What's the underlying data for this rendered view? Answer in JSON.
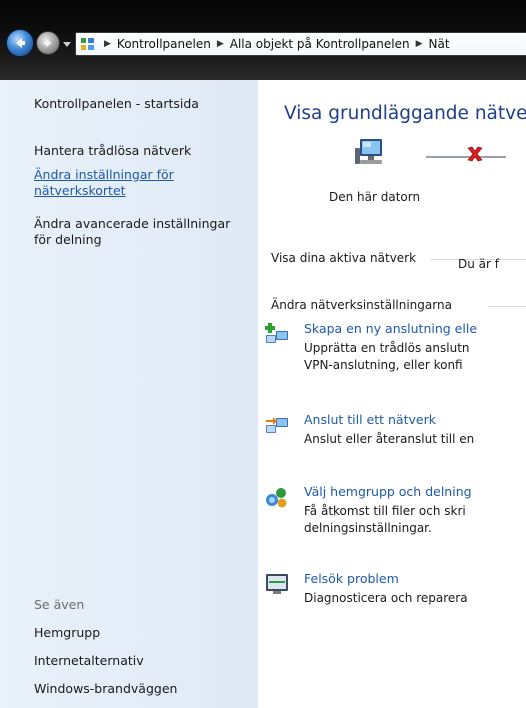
{
  "address": {
    "crumbs": [
      "Kontrollpanelen",
      "Alla objekt på Kontrollpanelen",
      "Nät"
    ]
  },
  "sidebar": {
    "home": "Kontrollpanelen - startsida",
    "items": [
      {
        "label": "Hantera trådlösa nätverk"
      },
      {
        "label_line1": "Ändra inställningar för",
        "label_line2": "nätverkskortet"
      },
      {
        "label_line1": "Ändra avancerade inställningar",
        "label_line2": "för delning"
      }
    ],
    "see_also_title": "Se även",
    "see_also": [
      "Hemgrupp",
      "Internetalternativ",
      "Windows-brandväggen"
    ]
  },
  "main": {
    "title": "Visa grundläggande nätverk",
    "computer_label": "Den här datorn",
    "active_networks_header": "Visa dina aktiva nätverk",
    "active_networks_text": "Du är f",
    "change_settings_header": "Ändra nätverksinställningarna",
    "tasks": [
      {
        "link": "Skapa en ny anslutning elle",
        "desc1": "Upprätta en trådlös anslutn",
        "desc2": "VPN-anslutning, eller konfi"
      },
      {
        "link": "Anslut till ett nätverk",
        "desc1": "Anslut eller återanslut till en"
      },
      {
        "link": "Välj hemgrupp och delning",
        "desc1": "Få åtkomst till filer och skri",
        "desc2": "delningsinställningar."
      },
      {
        "link": "Felsök problem",
        "desc1": "Diagnosticera och reparera"
      }
    ]
  },
  "colors": {
    "link": "#1e5aa8",
    "title": "#1e3f8a",
    "sidebar_bg": "#e4edf7",
    "error_red": "#d81e1e"
  }
}
